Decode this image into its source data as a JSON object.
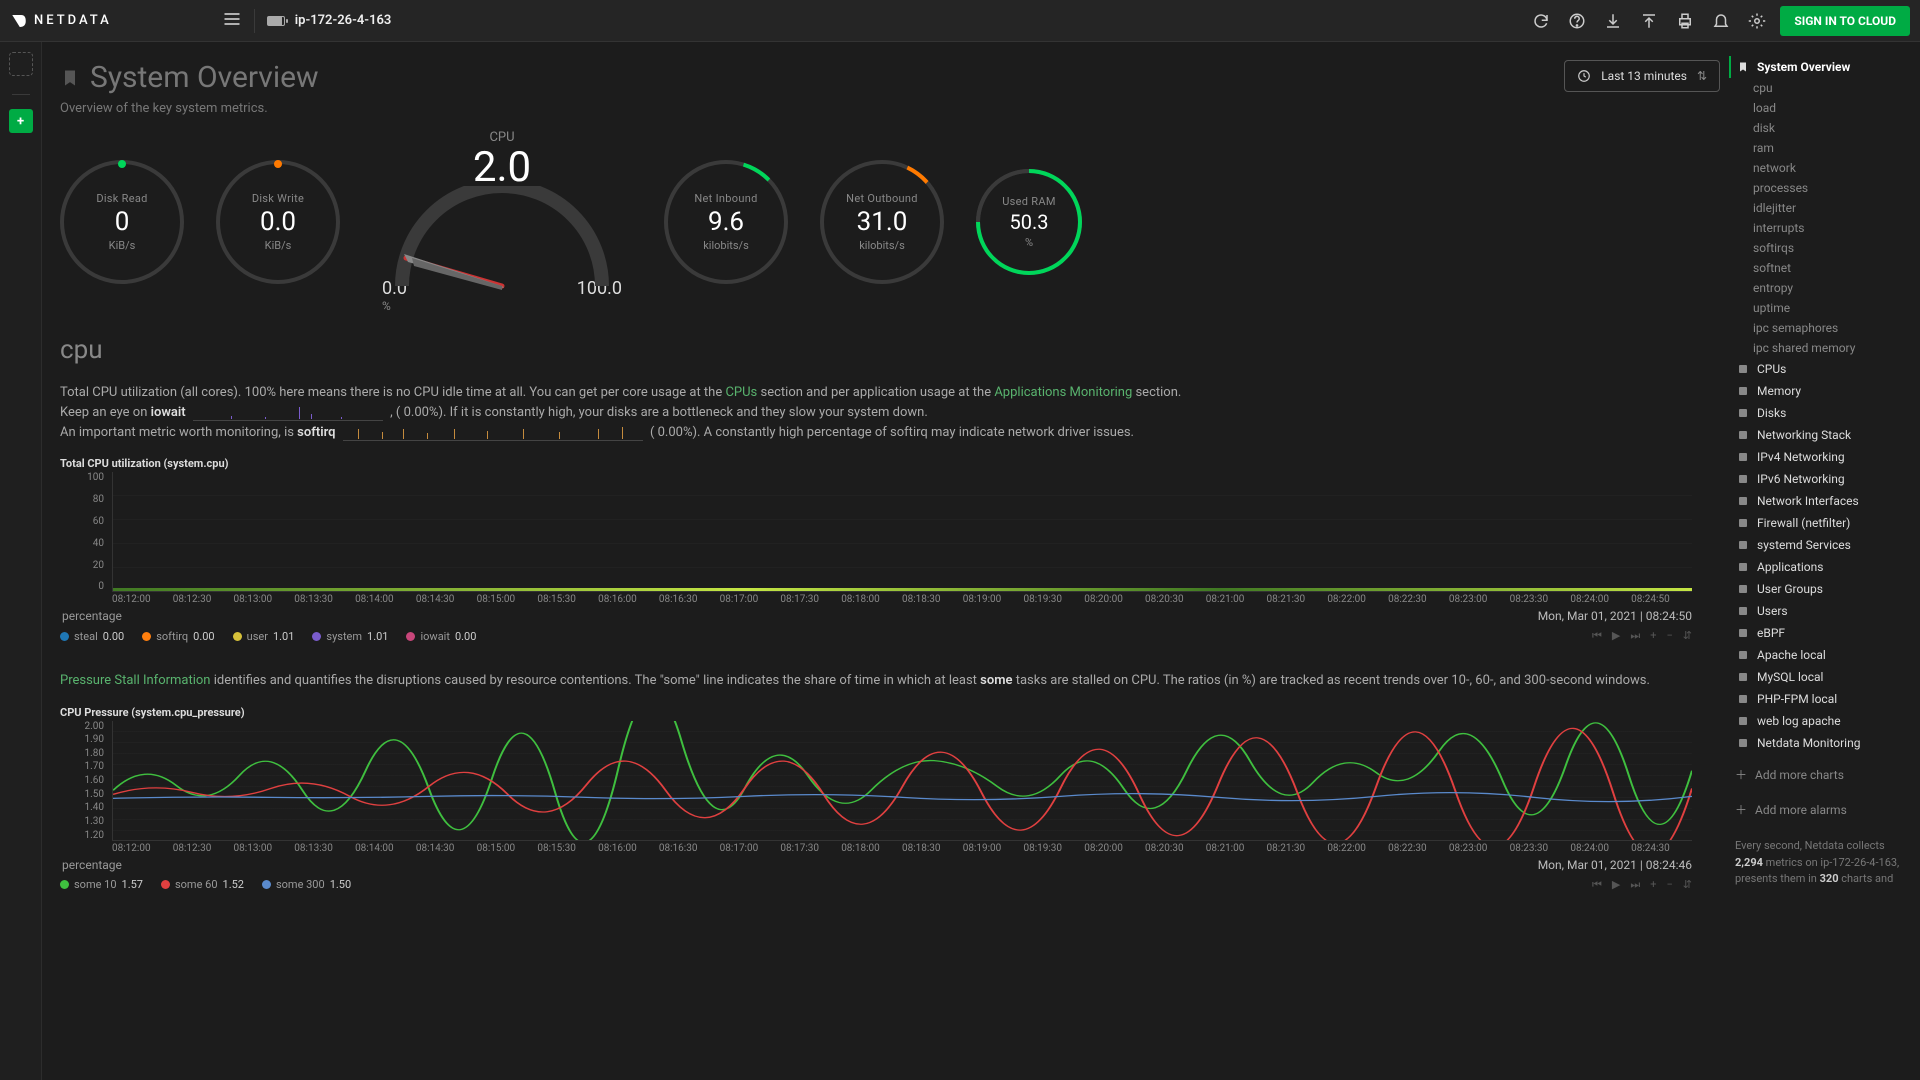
{
  "header": {
    "brand": "NETDATA",
    "hostname": "ip-172-26-4-163",
    "signin": "SIGN IN TO CLOUD",
    "timerange": "Last 13 minutes"
  },
  "title": "System Overview",
  "subtitle": "Overview of the key system metrics.",
  "gauges": {
    "disk_read": {
      "label": "Disk Read",
      "value": "0",
      "unit": "KiB/s"
    },
    "disk_write": {
      "label": "Disk Write",
      "value": "0.0",
      "unit": "KiB/s"
    },
    "cpu": {
      "label": "CPU",
      "value": "2.0",
      "min": "0.0",
      "max": "100.0",
      "unit": "%"
    },
    "net_in": {
      "label": "Net Inbound",
      "value": "9.6",
      "unit": "kilobits/s"
    },
    "net_out": {
      "label": "Net Outbound",
      "value": "31.0",
      "unit": "kilobits/s"
    },
    "ram": {
      "label": "Used RAM",
      "value": "50.3",
      "unit": "%"
    }
  },
  "cpu_section": {
    "heading": "cpu",
    "desc_pre": "Total CPU utilization (all cores). 100% here means there is no CPU idle time at all. You can get per core usage at the ",
    "link1": "CPUs",
    "desc_mid1": " section and per application usage at the ",
    "link2": "Applications Monitoring",
    "desc_post1": " section.",
    "line2_pre": "Keep an eye on ",
    "iowait_b": "iowait",
    "line2_mid": " 0.00%). If it is constantly high, your disks are a bottleneck and they slow your system down.",
    "line3_pre": "An important metric worth monitoring, is ",
    "softirq_b": "softirq",
    "line3_mid": " 0.00%). A constantly high percentage of softirq may indicate network driver issues."
  },
  "chart_data": [
    {
      "type": "area",
      "title": "Total CPU utilization (system.cpu)",
      "ylabel": "percentage",
      "ylim": [
        0,
        100
      ],
      "yticks": [
        100.0,
        80.0,
        60.0,
        40.0,
        20.0,
        0.0
      ],
      "xticks": [
        "08:12:00",
        "08:12:30",
        "08:13:00",
        "08:13:30",
        "08:14:00",
        "08:14:30",
        "08:15:00",
        "08:15:30",
        "08:16:00",
        "08:16:30",
        "08:17:00",
        "08:17:30",
        "08:18:00",
        "08:18:30",
        "08:19:00",
        "08:19:30",
        "08:20:00",
        "08:20:30",
        "08:21:00",
        "08:21:30",
        "08:22:00",
        "08:22:30",
        "08:23:00",
        "08:23:30",
        "08:24:00",
        "08:24:50"
      ],
      "timestamp": "Mon, Mar 01, 2021 | 08:24:50",
      "series": [
        {
          "name": "steal",
          "color": "#1f77b4FF",
          "value": "0.00"
        },
        {
          "name": "softirq",
          "color": "#ff7f0e",
          "value": "0.00"
        },
        {
          "name": "user",
          "color": "#d6c13a",
          "value": "1.01"
        },
        {
          "name": "system",
          "color": "#7a5ccc",
          "value": "1.01"
        },
        {
          "name": "iowait",
          "color": "#c8467a",
          "value": "0.00"
        }
      ]
    },
    {
      "type": "line",
      "title": "CPU Pressure (system.cpu_pressure)",
      "desc_link": "Pressure Stall Information",
      "desc": " identifies and quantifies the disruptions caused by resource contentions. The \"some\" line indicates the share of time in which at least ",
      "desc_b": "some",
      "desc_post": " tasks are stalled on CPU. The ratios (in %) are tracked as recent trends over 10-, 60-, and 300-second windows.",
      "ylabel": "percentage",
      "ylim": [
        1.2,
        2.0
      ],
      "yticks": [
        2.0,
        1.9,
        1.8,
        1.7,
        1.6,
        1.5,
        1.4,
        1.3,
        1.2
      ],
      "xticks": [
        "08:12:00",
        "08:12:30",
        "08:13:00",
        "08:13:30",
        "08:14:00",
        "08:14:30",
        "08:15:00",
        "08:15:30",
        "08:16:00",
        "08:16:30",
        "08:17:00",
        "08:17:30",
        "08:18:00",
        "08:18:30",
        "08:19:00",
        "08:19:30",
        "08:20:00",
        "08:20:30",
        "08:21:00",
        "08:21:30",
        "08:22:00",
        "08:22:30",
        "08:23:00",
        "08:23:30",
        "08:24:00",
        "08:24:30"
      ],
      "timestamp": "Mon, Mar 01, 2021 | 08:24:46",
      "series": [
        {
          "name": "some 10",
          "color": "#3fbf3f",
          "value": "1.57"
        },
        {
          "name": "some 60",
          "color": "#e04040",
          "value": "1.52"
        },
        {
          "name": "some 300",
          "color": "#5a8acc",
          "value": "1.50"
        }
      ]
    }
  ],
  "sidebar": {
    "sections": [
      {
        "label": "System Overview",
        "active": true,
        "icon": "bookmark-icon",
        "subs": [
          "cpu",
          "load",
          "disk",
          "ram",
          "network",
          "processes",
          "idlejitter",
          "interrupts",
          "softirqs",
          "softnet",
          "entropy",
          "uptime",
          "ipc semaphores",
          "ipc shared memory"
        ]
      },
      {
        "label": "CPUs",
        "icon": "chip-icon"
      },
      {
        "label": "Memory",
        "icon": "ram-icon"
      },
      {
        "label": "Disks",
        "icon": "disk-icon"
      },
      {
        "label": "Networking Stack",
        "icon": "cloud-icon"
      },
      {
        "label": "IPv4 Networking",
        "icon": "cloud-icon"
      },
      {
        "label": "IPv6 Networking",
        "icon": "cloud-icon"
      },
      {
        "label": "Network Interfaces",
        "icon": "nic-icon"
      },
      {
        "label": "Firewall (netfilter)",
        "icon": "shield-icon"
      },
      {
        "label": "systemd Services",
        "icon": "grid-icon"
      },
      {
        "label": "Applications",
        "icon": "apps-icon"
      },
      {
        "label": "User Groups",
        "icon": "users-icon"
      },
      {
        "label": "Users",
        "icon": "user-icon"
      },
      {
        "label": "eBPF",
        "icon": "pulse-icon"
      },
      {
        "label": "Apache local",
        "icon": "eye-icon"
      },
      {
        "label": "MySQL local",
        "icon": "db-icon"
      },
      {
        "label": "PHP-FPM local",
        "icon": "eye-icon"
      },
      {
        "label": "web log apache",
        "icon": "file-icon"
      },
      {
        "label": "Netdata Monitoring",
        "icon": "chart-icon"
      }
    ],
    "add_charts": "Add more charts",
    "add_alarms": "Add more alarms",
    "footer_1": "Every second, Netdata collects ",
    "footer_b1": "2,294",
    "footer_2": " metrics on ip-172-26-4-163, presents them in ",
    "footer_b2": "320",
    "footer_3": " charts and"
  },
  "controls": {
    "rewind": "⏮",
    "play": "▶",
    "forward": "⏭",
    "plus": "+",
    "minus": "−",
    "updown": "⇵"
  }
}
